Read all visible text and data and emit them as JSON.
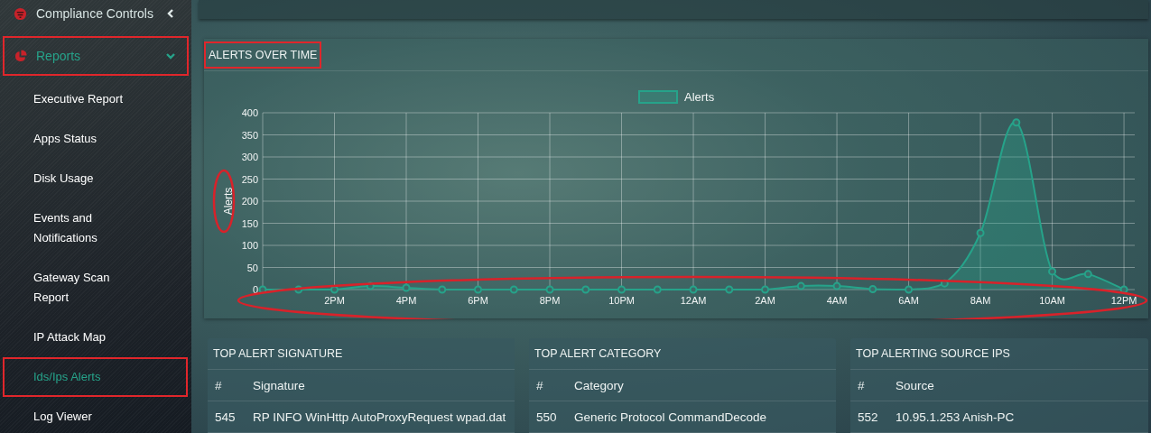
{
  "sidebar": {
    "items": [
      {
        "label": "Compliance Controls",
        "kind": "section",
        "selected": false,
        "expanded": false,
        "highlighted": false
      },
      {
        "label": "Reports",
        "kind": "section",
        "selected": true,
        "expanded": true,
        "highlighted": true,
        "children": [
          {
            "label": "Executive Report",
            "selected": false,
            "highlighted": false
          },
          {
            "label": "Apps Status",
            "selected": false,
            "highlighted": false
          },
          {
            "label": "Disk Usage",
            "selected": false,
            "highlighted": false
          },
          {
            "label": "Events and Notifications",
            "selected": false,
            "highlighted": false
          },
          {
            "label": "Gateway Scan Report",
            "selected": false,
            "highlighted": false
          },
          {
            "label": "IP Attack Map",
            "selected": false,
            "highlighted": false
          },
          {
            "label": "Ids/Ips Alerts",
            "selected": true,
            "highlighted": true
          },
          {
            "label": "Log Viewer",
            "selected": false,
            "highlighted": false
          }
        ]
      }
    ]
  },
  "alerts_panel": {
    "title": "ALERTS OVER TIME",
    "highlighted": true,
    "ylabel_highlighted": true,
    "xaxis_highlighted": true,
    "chart_data": {
      "type": "area",
      "ylabel": "Alerts",
      "grid": true,
      "categories": [
        null,
        null,
        "2PM",
        null,
        "4PM",
        null,
        "6PM",
        null,
        "8PM",
        null,
        "10PM",
        null,
        "12AM",
        null,
        "2AM",
        null,
        "4AM",
        null,
        "6AM",
        null,
        "8AM",
        null,
        "10AM",
        null,
        "12PM"
      ],
      "series": [
        {
          "name": "Alerts",
          "color": "#26a38a",
          "values": [
            0,
            0,
            0,
            8,
            4,
            0,
            0,
            0,
            0,
            0,
            0,
            0,
            0,
            0,
            0,
            8,
            8,
            1,
            0,
            14,
            128,
            378,
            41,
            35,
            0
          ]
        }
      ],
      "ylim": [
        0,
        400
      ],
      "yticks": [
        0,
        50,
        100,
        150,
        200,
        250,
        300,
        350,
        400
      ]
    }
  },
  "tables": [
    {
      "title": "TOP ALERT SIGNATURE",
      "columns": [
        "#",
        "Signature"
      ],
      "rows": [
        [
          "545",
          "RP INFO WinHttp AutoProxyRequest wpad.dat"
        ]
      ]
    },
    {
      "title": "TOP ALERT CATEGORY",
      "columns": [
        "#",
        "Category"
      ],
      "rows": [
        [
          "550",
          "Generic Protocol CommandDecode"
        ]
      ]
    },
    {
      "title": "TOP ALERTING SOURCE IPS",
      "columns": [
        "#",
        "Source"
      ],
      "rows": [
        [
          "552",
          "10.95.1.253 Anish-PC"
        ]
      ]
    }
  ]
}
